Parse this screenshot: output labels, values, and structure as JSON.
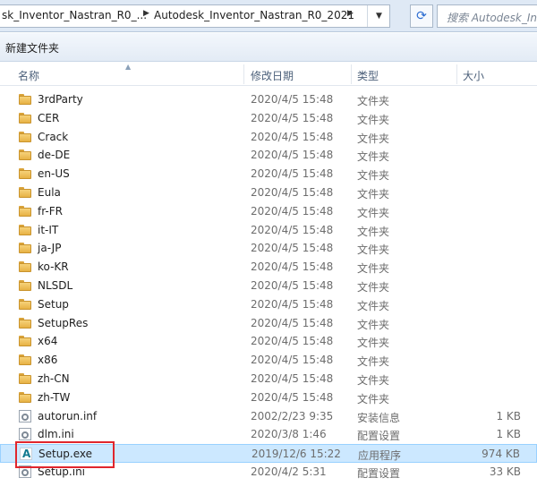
{
  "address": {
    "crumbs": [
      "sk_Inventor_Nastran_R0_...",
      "Autodesk_Inventor_Nastran_R0_2021"
    ],
    "separator": "▶",
    "dropdown": "▼"
  },
  "search": {
    "placeholder": "搜索 Autodesk_In"
  },
  "toolbar": {
    "new_folder": "新建文件夹"
  },
  "columns": {
    "name": "名称",
    "date": "修改日期",
    "type": "类型",
    "size": "大小"
  },
  "files": [
    {
      "name": "3rdParty",
      "date": "2020/4/5 15:48",
      "type": "文件夹",
      "size": "",
      "icon": "folder-icon"
    },
    {
      "name": "CER",
      "date": "2020/4/5 15:48",
      "type": "文件夹",
      "size": "",
      "icon": "folder-icon"
    },
    {
      "name": "Crack",
      "date": "2020/4/5 15:48",
      "type": "文件夹",
      "size": "",
      "icon": "folder-icon"
    },
    {
      "name": "de-DE",
      "date": "2020/4/5 15:48",
      "type": "文件夹",
      "size": "",
      "icon": "folder-icon"
    },
    {
      "name": "en-US",
      "date": "2020/4/5 15:48",
      "type": "文件夹",
      "size": "",
      "icon": "folder-icon"
    },
    {
      "name": "Eula",
      "date": "2020/4/5 15:48",
      "type": "文件夹",
      "size": "",
      "icon": "folder-icon"
    },
    {
      "name": "fr-FR",
      "date": "2020/4/5 15:48",
      "type": "文件夹",
      "size": "",
      "icon": "folder-icon"
    },
    {
      "name": "it-IT",
      "date": "2020/4/5 15:48",
      "type": "文件夹",
      "size": "",
      "icon": "folder-icon"
    },
    {
      "name": "ja-JP",
      "date": "2020/4/5 15:48",
      "type": "文件夹",
      "size": "",
      "icon": "folder-icon"
    },
    {
      "name": "ko-KR",
      "date": "2020/4/5 15:48",
      "type": "文件夹",
      "size": "",
      "icon": "folder-icon"
    },
    {
      "name": "NLSDL",
      "date": "2020/4/5 15:48",
      "type": "文件夹",
      "size": "",
      "icon": "folder-icon"
    },
    {
      "name": "Setup",
      "date": "2020/4/5 15:48",
      "type": "文件夹",
      "size": "",
      "icon": "folder-icon"
    },
    {
      "name": "SetupRes",
      "date": "2020/4/5 15:48",
      "type": "文件夹",
      "size": "",
      "icon": "folder-icon"
    },
    {
      "name": "x64",
      "date": "2020/4/5 15:48",
      "type": "文件夹",
      "size": "",
      "icon": "folder-icon"
    },
    {
      "name": "x86",
      "date": "2020/4/5 15:48",
      "type": "文件夹",
      "size": "",
      "icon": "folder-icon"
    },
    {
      "name": "zh-CN",
      "date": "2020/4/5 15:48",
      "type": "文件夹",
      "size": "",
      "icon": "folder-icon"
    },
    {
      "name": "zh-TW",
      "date": "2020/4/5 15:48",
      "type": "文件夹",
      "size": "",
      "icon": "folder-icon"
    },
    {
      "name": "autorun.inf",
      "date": "2002/2/23 9:35",
      "type": "安装信息",
      "size": "1 KB",
      "icon": "settings-file-icon"
    },
    {
      "name": "dlm.ini",
      "date": "2020/3/8 1:46",
      "type": "配置设置",
      "size": "1 KB",
      "icon": "settings-file-icon"
    },
    {
      "name": "Setup.exe",
      "date": "2019/12/6 15:22",
      "type": "应用程序",
      "size": "974 KB",
      "icon": "autodesk-app-icon",
      "selected": true
    },
    {
      "name": "Setup.ini",
      "date": "2020/4/2 5:31",
      "type": "配置设置",
      "size": "33 KB",
      "icon": "settings-file-icon"
    }
  ],
  "colors": {
    "selection": "#cce8ff",
    "highlight_box": "#e0262d",
    "folder": "#e7b245"
  }
}
